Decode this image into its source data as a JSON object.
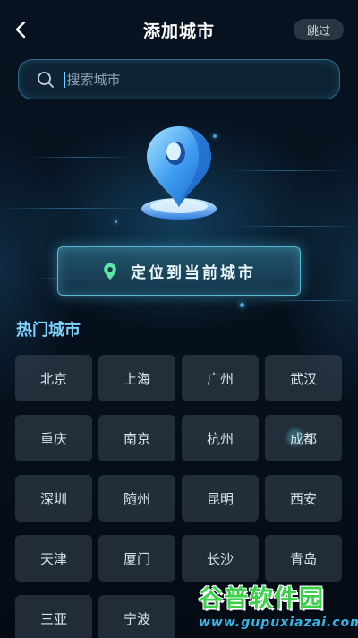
{
  "header": {
    "title": "添加城市",
    "skip_label": "跳过"
  },
  "search": {
    "placeholder": "搜索城市",
    "value": ""
  },
  "locate": {
    "label": "定位到当前城市"
  },
  "hot": {
    "title": "热门城市",
    "cities": [
      "北京",
      "上海",
      "广州",
      "武汉",
      "重庆",
      "南京",
      "杭州",
      "成都",
      "深圳",
      "随州",
      "昆明",
      "西安",
      "天津",
      "厦门",
      "长沙",
      "青岛",
      "三亚",
      "宁波"
    ]
  },
  "watermark": {
    "main": "谷普软件园",
    "sub": "www.gupuxiazai.com"
  },
  "colors": {
    "accent": "#7fd3ff",
    "background": "#050b14",
    "watermark_green": "#3bd04a"
  },
  "icons": {
    "back": "chevron-left-icon",
    "search": "search-icon",
    "pin": "location-pin-icon",
    "locate": "location-marker-icon"
  }
}
